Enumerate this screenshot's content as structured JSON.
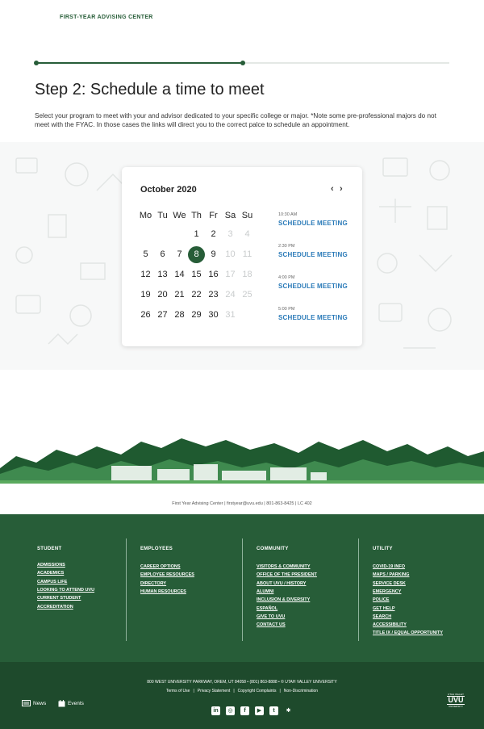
{
  "header": {
    "label": "FIRST-YEAR ADVISING CENTER"
  },
  "progress": {
    "value": 0.5
  },
  "step": {
    "title": "Step 2: Schedule a time to meet",
    "description": "Select your program to meet with your and advisor dedicated to your specific college or major. *Note some pre-professional majors do not meet with the FYAC. In those cases the links will direct you to the correct palce to schedule an appointment."
  },
  "calendar": {
    "month": "October 2020",
    "prev": "‹",
    "next": "›",
    "weekdays": [
      "Mo",
      "Tu",
      "We",
      "Th",
      "Fr",
      "Sa",
      "Su"
    ],
    "weeks": [
      [
        "",
        "",
        "",
        "1",
        "2",
        "3",
        "4"
      ],
      [
        "5",
        "6",
        "7",
        "8",
        "9",
        "10",
        "11"
      ],
      [
        "12",
        "13",
        "14",
        "15",
        "16",
        "17",
        "18"
      ],
      [
        "19",
        "20",
        "21",
        "22",
        "23",
        "24",
        "25"
      ],
      [
        "26",
        "27",
        "28",
        "29",
        "30",
        "31",
        ""
      ]
    ],
    "disabled": [
      "3",
      "4",
      "10",
      "11",
      "17",
      "18",
      "24",
      "25",
      "31"
    ],
    "selected": "8",
    "slots": [
      {
        "time": "10:30 AM",
        "action": "SCHEDULE MEETING"
      },
      {
        "time": "2:30 PM",
        "action": "SCHEDULE MEETING"
      },
      {
        "time": "4:00 PM",
        "action": "SCHEDULE MEETING"
      },
      {
        "time": "5:00 PM",
        "action": "SCHEDULE MEETING"
      }
    ]
  },
  "info_line": "First Year Advising Center  |  firstyear@uvu.edu  |  801-863-8425  |  LC 402",
  "footer": {
    "columns": [
      {
        "title": "STUDENT",
        "links": [
          "ADMISSIONS",
          "ACADEMICS",
          "CAMPUS LIFE",
          "LOOKING TO ATTEND UVU",
          "CURRENT STUDENT",
          "ACCREDITATION"
        ]
      },
      {
        "title": "EMPLOYEES",
        "links": [
          "CAREER OPTIONS",
          "EMPLOYEE RESOURCES",
          "DIRECTORY",
          "HUMAN RESOURCES"
        ]
      },
      {
        "title": "COMMUNITY",
        "links": [
          "VISITORS & COMMUNITY",
          "OFFICE OF THE PRESIDENT",
          "ABOUT UVU / HISTORY",
          "ALUMNI",
          "INCLUSION & DIVERSITY",
          "ESPAÑOL",
          "GIVE TO UVU",
          "CONTACT US"
        ]
      },
      {
        "title": "UTILITY",
        "links": [
          "COVID-19 INFO",
          "MAPS / PARKING",
          "SERVICE DESK",
          "EMERGENCY",
          "POLICE",
          "GET HELP",
          "SEARCH",
          "ACCESSIBILITY",
          "TITLE IX / EQUAL OPPORTUNITY"
        ]
      }
    ]
  },
  "bottom": {
    "address": "800 WEST UNIVERSITY PARKWAY, OREM, UT 84058 • (801) 863-8888 • © UTAH VALLEY UNIVERSITY",
    "legal": [
      "Terms of Use",
      "Privacy Statement",
      "Copyright Complaints",
      "Non-Discrimination"
    ],
    "news": "News",
    "events": "Events",
    "logo_top": "UTAH VALLEY",
    "logo_main": "UVU",
    "logo_bottom": "UNIVERSITY"
  }
}
